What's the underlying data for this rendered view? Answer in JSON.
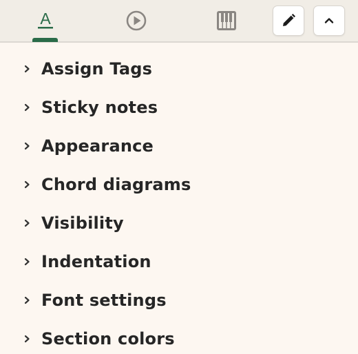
{
  "toolbar": {
    "tabs": [
      {
        "name": "text-tab",
        "icon": "text-format-icon",
        "glyph": "A",
        "active": true
      },
      {
        "name": "playback-tab",
        "icon": "play-circle-icon",
        "active": false
      },
      {
        "name": "piano-tab",
        "icon": "piano-icon",
        "active": false
      }
    ],
    "buttons": [
      {
        "name": "edit-button",
        "icon": "pencil-icon"
      },
      {
        "name": "collapse-button",
        "icon": "chevron-up-icon"
      }
    ],
    "accent_color": "#2a6b48"
  },
  "menu": {
    "items": [
      {
        "label": "Assign Tags"
      },
      {
        "label": "Sticky notes"
      },
      {
        "label": "Appearance"
      },
      {
        "label": "Chord diagrams"
      },
      {
        "label": "Visibility"
      },
      {
        "label": "Indentation"
      },
      {
        "label": "Font settings"
      },
      {
        "label": "Section colors"
      }
    ],
    "item_icon": "chevron-right-icon"
  }
}
